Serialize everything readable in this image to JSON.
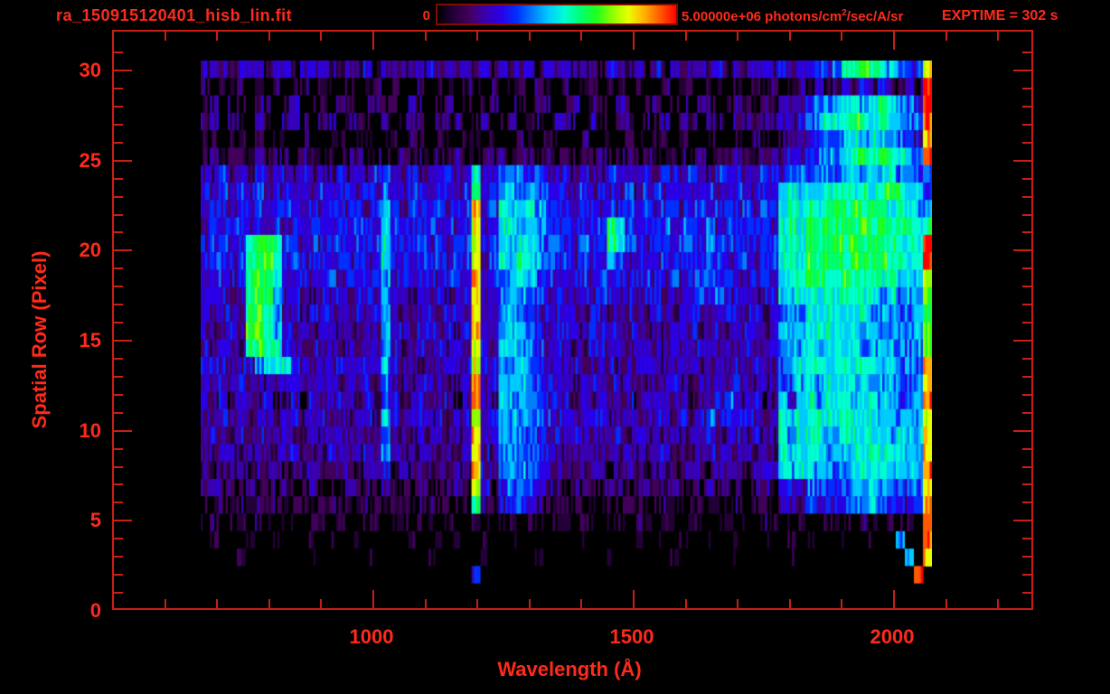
{
  "window": {
    "background": "#000000"
  },
  "header": {
    "title": "ra_150915120401_hisb_lin.fit",
    "exptime_label": "EXPTIME = 302 s"
  },
  "colorbar": {
    "min_label": "0",
    "max_label": "5.00000e+06",
    "units_prefix": " photons/cm",
    "units_sup": "2",
    "units_suffix": "/sec/A/sr"
  },
  "style_colors": {
    "text_red": "#ff2a1a",
    "frame_red": "#c81e14",
    "background": "#000000"
  },
  "axes": {
    "x": {
      "title": "Wavelength (Å)",
      "major_tick_values": [
        1000,
        1500,
        2000
      ],
      "major_tick_labels": [
        "1000",
        "1500",
        "2000"
      ],
      "minor_tick_step": 100,
      "minor_tick_range": [
        600,
        2200
      ],
      "range_angstrom": [
        502,
        2271
      ]
    },
    "y": {
      "title": "Spatial Row (Pixel)",
      "major_tick_values": [
        0,
        5,
        10,
        15,
        20,
        25,
        30
      ],
      "major_tick_labels": [
        "0",
        "5",
        "10",
        "15",
        "20",
        "25",
        "30"
      ],
      "minor_tick_step": 1,
      "range_rows": [
        0,
        32
      ]
    }
  },
  "chart_data": {
    "type": "heatmap",
    "title": "ra_150915120401_hisb_lin.fit",
    "xlabel": "Wavelength (Å)",
    "ylabel": "Spatial Row (Pixel)",
    "value_range": [
      0,
      5000000
    ],
    "value_units": "photons/cm^2/sec/A/sr",
    "exposure": "EXPTIME = 302 s",
    "x_extent_angstrom": [
      695,
      2077
    ],
    "y_extent_rows": [
      0,
      30
    ],
    "legend_position": "top colorbar",
    "grid_on": false,
    "intensity_encoding": "each character is a hex digit 0-15 mapping linearly to 0..5e6 via colormap",
    "row_order": "top_to_bottom (first string = row 30, last = row 0)",
    "notable_features": [
      "bright Lyman-alpha emission column near 1216 A (orange/red, rows 5-24)",
      "cyan emission column near 1025 A (rows 7-23)",
      "green crescent blob near 780-830 A (rows 13-20)",
      "cyan line near 1790 A and broad green band 1820-2060 A (rows 5-30)",
      "red detector edge near 2065 A",
      "faint sparse noise rows 1-4 and 25-30"
    ],
    "colormap": [
      "#000000",
      "#240038",
      "#43005c",
      "#3a00b0",
      "#2a00e8",
      "#0030ff",
      "#0080ff",
      "#00ccff",
      "#00ffd0",
      "#00ff70",
      "#20ff20",
      "#90ff00",
      "#e8ff00",
      "#ffb000",
      "#ff5800",
      "#ff0000"
    ],
    "grid": [
      "3432434243243432434243243424333424334243433424334242433434243443434455689a987655c",
      "20212021201202102012021020120210201202102012021020120120210202120232323435343232f",
      "23022032023022032023220320230202302203202302203202302203202322323435677897898765f",
      "230320320332033023203023203230230230320332032033022303203203323343467889a9898766e",
      "12011020110210120110110210120120110210110120110210120110201102112234566787876654d",
      "2312213122132212231221322122311223122132212231221312221312232233344567789a9a9876e",
      "43534353443534353435543534353484466655444354354435354354354543544566666787878665 6",
      "4453545345453544535465454354459457767655445454453554454454454454787888898989a9875",
      "455454545554545545457545545455d4587887655455454555455455455454558989 89a9a9a989877",
      "454554545454554545547554554545c4588787655454698545564654645555548 98a9a9a9a9a99989",
      "4554599a9554545545458554545455c4587887655465598654554664655554558 98a9aa9a9a99887e",
      "455459aa955455454545854554545 5c46879876554554654544554546545545589 8a9aa9aa9a9888f",
      "445449aa844544545445745445454 4d4577876544554645445446455645444547 889999a99989787c",
      "444349aa74443444344474434443 44d44677654444445444344344454644434477 88898988878677a",
      "434439a9744344434434743444344 3d43676544444344344434434443444443467 78888878777667a",
      "43443ab974443443434474434434 34d43777654444344434434344434434443477 78888887877667b",
      "434339a98443434343347433434 343c43777654443344343344343344334433467 78788887787667b",
      "44434478885434443444744434443 4c44777654444344434444344434434443467 88888988878676d",
      "4343434334433443434364334343 34e44777654443343434334343343434433466 78788878777667d",
      "43424334234243343243642343342 4e43777654442434334243343243464342374 78788878877667e",
      "4353434434434434344374344343 44c45777765443444344344434346444443487 88888888878777c",
      "34334343343343343433633343 4334d4477765443434334343334343433434338788877888887877d",
      "33433343334333433343633334 3334d4377765443334333433343333433333338788877788988877d",
      "32333233323332333233523233 3233d4367765443233323332332333233323337 788776788887877e",
      "2322232223223222322232223 22232c42566543323222322232232223222223245466656778766 56d",
      "21222122212212221222222122 21229324554322212221222122122212221221343555456676554 5d",
      "1201102101102101102101102101102101102101102101102101102101101021012101110210121 0e",
      "0100010010001010010010010010100100100100001001001010010010010010010100010010070 0e",
      "0000100000001000001000000100000100000100000001000000100000010000010000000000007 0d",
      "00000000000000000000000000000050000000000000000000000000000000000000000000000 00f",
      "000000000000000000000000000000000000000000000000000000000000000000000000000000000"
    ]
  }
}
